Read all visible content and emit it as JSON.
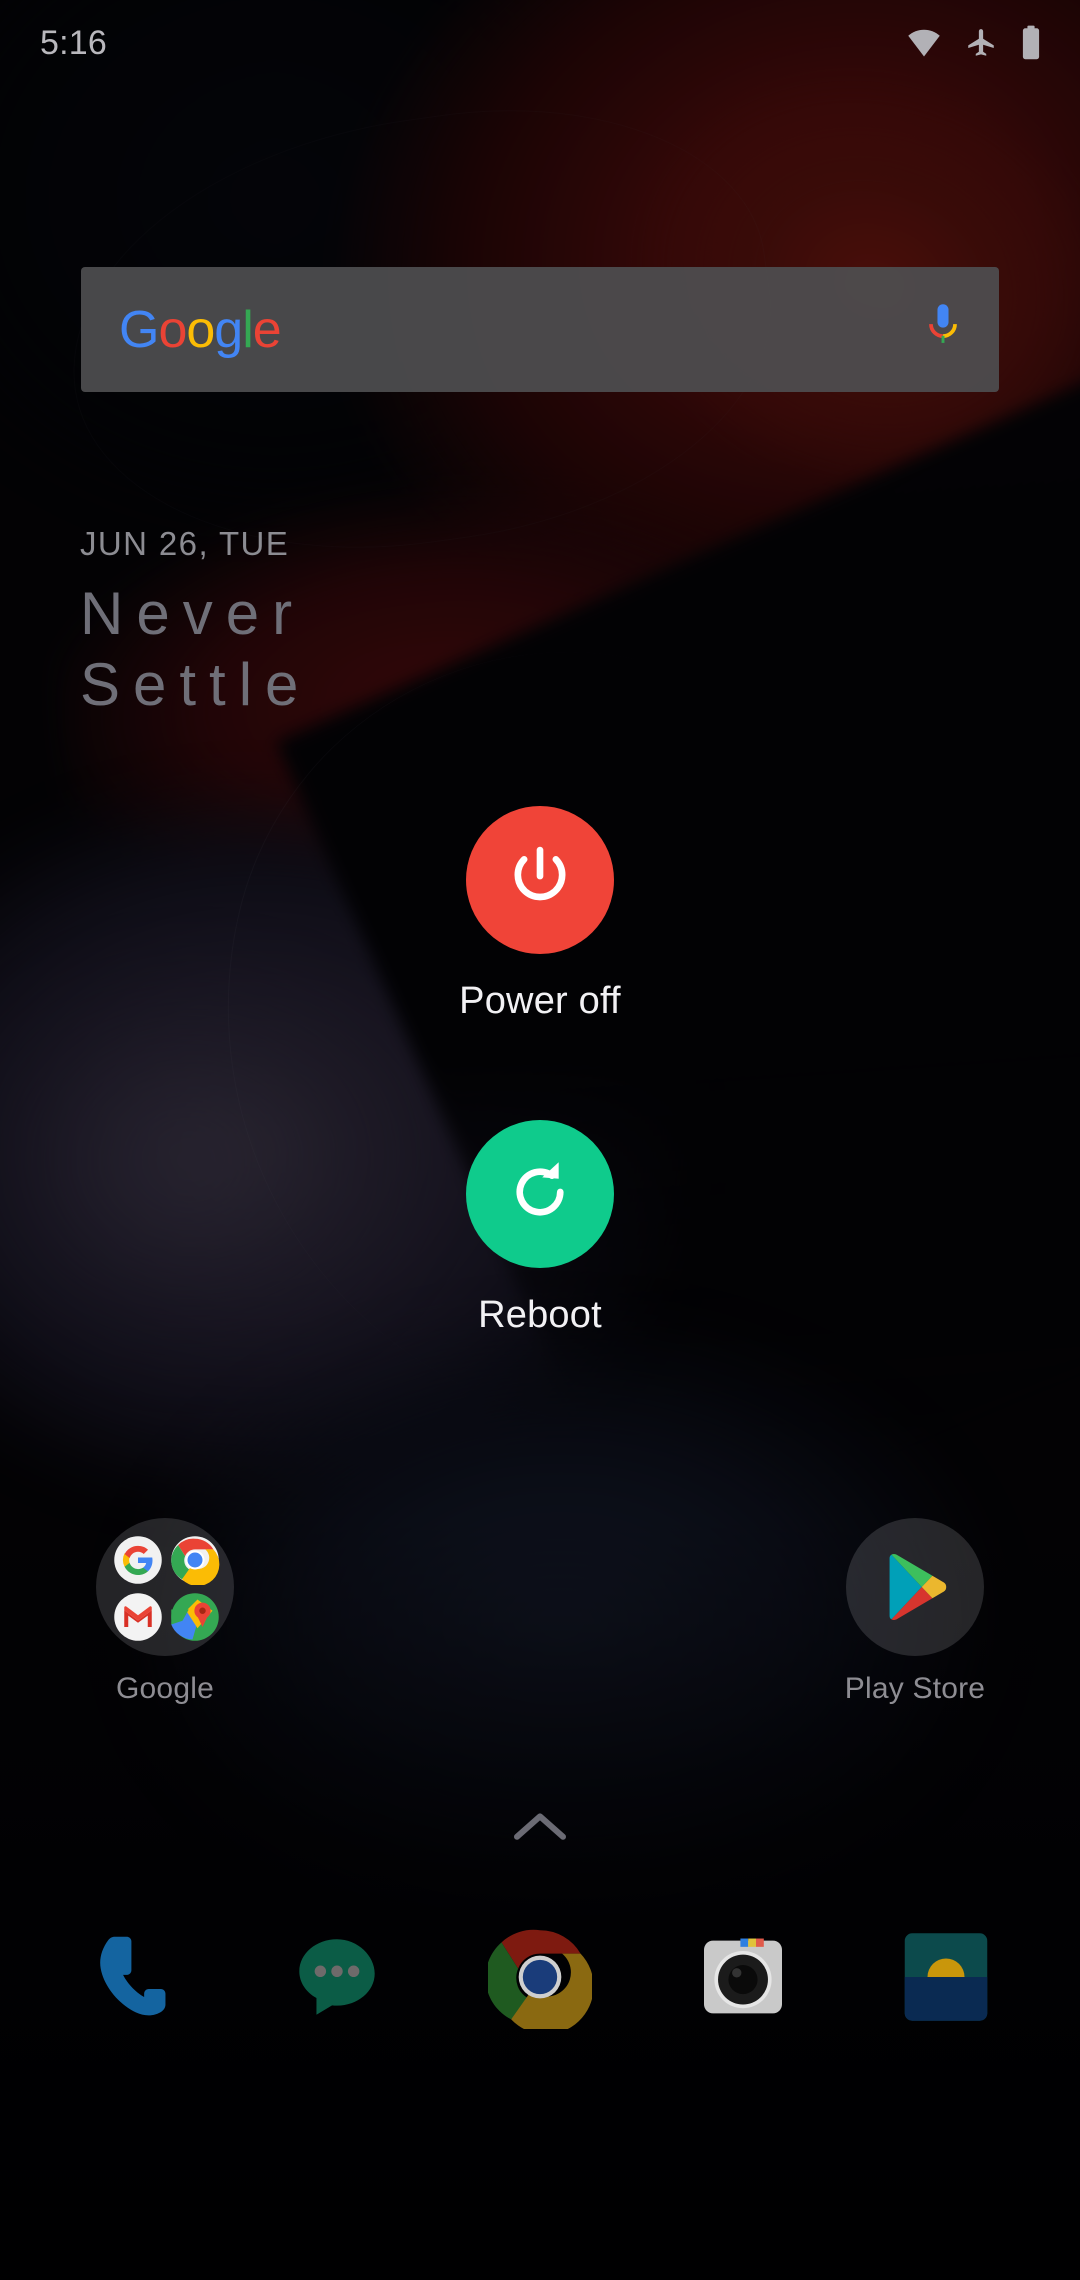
{
  "status_bar": {
    "time": "5:16",
    "icons": [
      {
        "name": "wifi-icon",
        "label": "Wi-Fi"
      },
      {
        "name": "airplane-mode-icon",
        "label": "Airplane mode"
      },
      {
        "name": "battery-icon",
        "label": "Battery full"
      }
    ]
  },
  "search_widget": {
    "logo_letters": [
      "G",
      "o",
      "o",
      "g",
      "l",
      "e"
    ],
    "mic_icon": "microphone-icon"
  },
  "clock_widget": {
    "date": "JUN 26, TUE",
    "line1": "Never",
    "line2": "Settle"
  },
  "power_menu": {
    "items": [
      {
        "label": "Power off",
        "icon": "power-icon",
        "color": "#F04438"
      },
      {
        "label": "Reboot",
        "icon": "restart-icon",
        "color": "#0FCB8C"
      }
    ]
  },
  "home_apps": [
    {
      "label": "Google",
      "type": "folder",
      "icon": "google-folder-icon",
      "contents": [
        "google-icon",
        "chrome-icon",
        "gmail-icon",
        "maps-icon"
      ]
    },
    {
      "label": "Play Store",
      "type": "app",
      "icon": "play-store-icon"
    }
  ],
  "app_drawer": {
    "icon": "chevron-up-icon"
  },
  "dock": [
    {
      "label": "Phone",
      "icon": "phone-icon"
    },
    {
      "label": "Messages",
      "icon": "messages-icon"
    },
    {
      "label": "Chrome",
      "icon": "chrome-icon"
    },
    {
      "label": "Camera",
      "icon": "camera-icon"
    },
    {
      "label": "Gallery",
      "icon": "gallery-icon"
    }
  ],
  "colors": {
    "power_off": "#F04438",
    "reboot": "#0FCB8C",
    "widget_bg": "#4E4E50",
    "label_text": "#F2F1F4"
  }
}
